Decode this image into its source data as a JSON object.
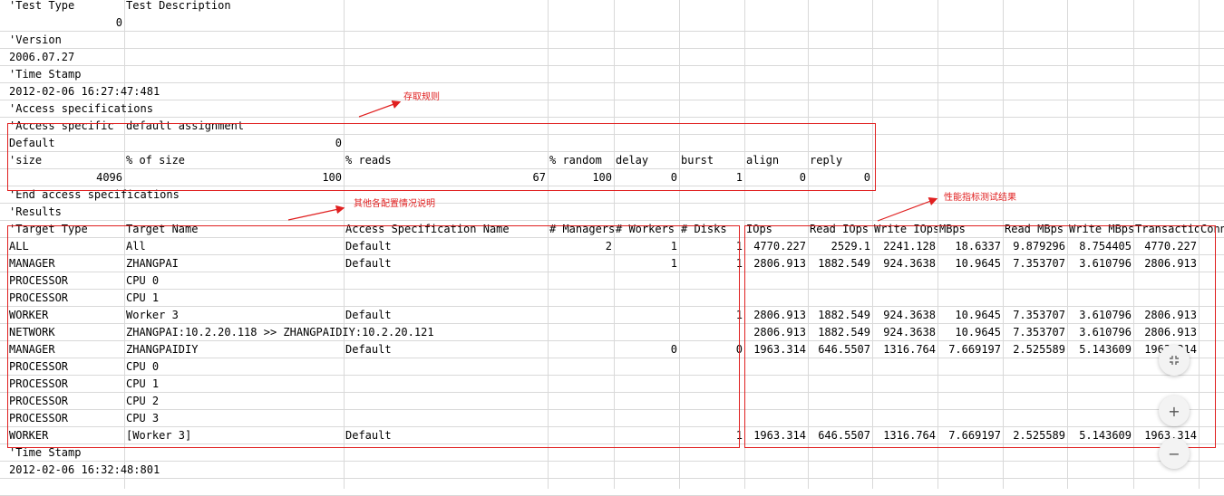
{
  "colors": {
    "annotation": "#e02020",
    "grid": "#d9d9d9"
  },
  "header": {
    "test_type_label": "'Test Type",
    "test_description_label": "Test Description",
    "test_type_value": "0",
    "version_label": "'Version",
    "version_value": "2006.07.27",
    "timestamp_label": "'Time Stamp",
    "timestamp_value": "2012-02-06 16:27:47:481",
    "access_specs_label": "'Access specifications"
  },
  "access": {
    "spec_label": "'Access specific",
    "assignment": "default assignment",
    "default_name": "Default",
    "default_value": "0",
    "columns": [
      "'size",
      "% of size",
      "% reads",
      "% random",
      "delay",
      "burst",
      "align",
      "reply"
    ],
    "values": [
      "4096",
      "100",
      "67",
      "100",
      "0",
      "1",
      "0",
      "0"
    ],
    "end_label": "'End access specifications"
  },
  "results": {
    "label": "'Results",
    "columns": [
      "'Target Type",
      "Target Name",
      "Access Specification Name",
      "# Managers",
      "# Workers",
      "# Disks",
      "IOps",
      "Read IOps",
      "Write IOps",
      "MBps",
      "Read MBps",
      "Write MBps",
      "Transactions",
      "Conn"
    ],
    "rows": [
      [
        "ALL",
        "All",
        "Default",
        "2",
        "1",
        "1",
        "4770.227",
        "2529.1",
        "2241.128",
        "18.6337",
        "9.879296",
        "8.754405",
        "4770.227"
      ],
      [
        "MANAGER",
        "ZHANGPAI",
        "Default",
        "",
        "1",
        "1",
        "2806.913",
        "1882.549",
        "924.3638",
        "10.9645",
        "7.353707",
        "3.610796",
        "2806.913"
      ],
      [
        "PROCESSOR",
        "CPU 0",
        "",
        "",
        "",
        "",
        "",
        "",
        "",
        "",
        "",
        "",
        ""
      ],
      [
        "PROCESSOR",
        "CPU 1",
        "",
        "",
        "",
        "",
        "",
        "",
        "",
        "",
        "",
        "",
        ""
      ],
      [
        "WORKER",
        "Worker 3",
        "Default",
        "",
        "",
        "1",
        "2806.913",
        "1882.549",
        "924.3638",
        "10.9645",
        "7.353707",
        "3.610796",
        "2806.913"
      ],
      [
        "NETWORK",
        "ZHANGPAI:10.2.20.118 >> ZHANGPAIDIY:10.2.20.121",
        "",
        "",
        "",
        "",
        "2806.913",
        "1882.549",
        "924.3638",
        "10.9645",
        "7.353707",
        "3.610796",
        "2806.913"
      ],
      [
        "MANAGER",
        "ZHANGPAIDIY",
        "Default",
        "",
        "0",
        "0",
        "1963.314",
        "646.5507",
        "1316.764",
        "7.669197",
        "2.525589",
        "5.143609",
        "1963.314"
      ],
      [
        "PROCESSOR",
        "CPU 0",
        "",
        "",
        "",
        "",
        "",
        "",
        "",
        "",
        "",
        "",
        ""
      ],
      [
        "PROCESSOR",
        "CPU 1",
        "",
        "",
        "",
        "",
        "",
        "",
        "",
        "",
        "",
        "",
        ""
      ],
      [
        "PROCESSOR",
        "CPU 2",
        "",
        "",
        "",
        "",
        "",
        "",
        "",
        "",
        "",
        "",
        ""
      ],
      [
        "PROCESSOR",
        "CPU 3",
        "",
        "",
        "",
        "",
        "",
        "",
        "",
        "",
        "",
        "",
        ""
      ],
      [
        "WORKER",
        "[Worker 3]",
        "Default",
        "",
        "",
        "1",
        "1963.314",
        "646.5507",
        "1316.764",
        "7.669197",
        "2.525589",
        "5.143609",
        "1963.314"
      ]
    ]
  },
  "footer": {
    "timestamp_label": "'Time Stamp",
    "timestamp_value": "2012-02-06 16:32:48:801"
  },
  "annotations": {
    "access_rule": "存取规则",
    "config_desc": "其他各配置情况说明",
    "perf_results": "性能指标测试结果"
  },
  "zoom": {
    "fit_icon": "fit-screen-icon",
    "zoom_in": "+",
    "zoom_out": "−"
  }
}
